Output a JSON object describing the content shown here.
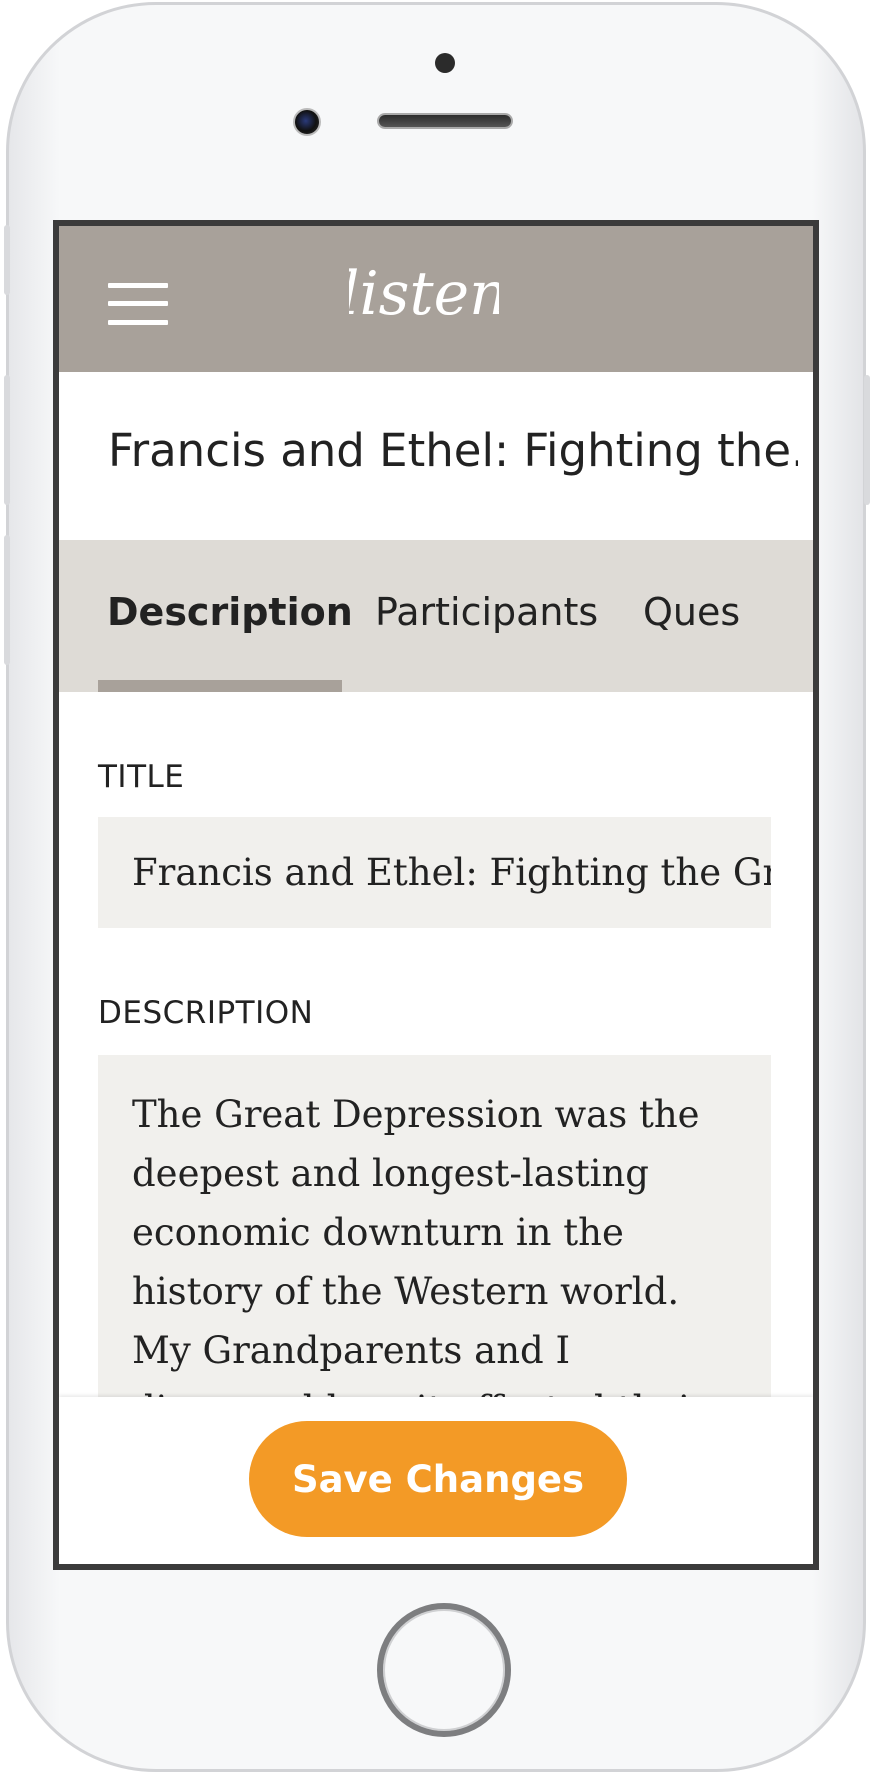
{
  "app": {
    "logo_text": "listen",
    "menu_icon": "hamburger-icon"
  },
  "story": {
    "title": "Francis and Ethel: Fighting the..."
  },
  "tabs": [
    {
      "label": "Description",
      "active": true
    },
    {
      "label": "Participants",
      "active": false
    },
    {
      "label": "Ques",
      "active": false
    }
  ],
  "form": {
    "title_label": "TITLE",
    "title_value": "Francis and Ethel: Fighting the Grea",
    "description_label": "DESCRIPTION",
    "description_value": "The Great Depression was the deepest and longest-lasting economic downturn in the history of the Western world. My Grandparents and I discussed how it affected their lives and"
  },
  "footer": {
    "save_label": "Save Changes"
  },
  "colors": {
    "appbar": "#a8a19a",
    "tabs_bg": "#dedbd6",
    "field_bg": "#f1f0ed",
    "accent": "#f39a26"
  }
}
